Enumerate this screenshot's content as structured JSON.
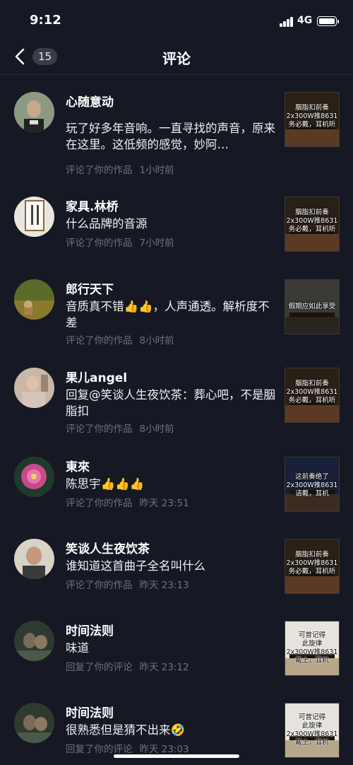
{
  "status_bar": {
    "time": "9:12",
    "network": "4G"
  },
  "nav": {
    "back_icon": "chevron-left-icon",
    "badge_count": "15",
    "title": "评论"
  },
  "items": [
    {
      "user": "心随意动",
      "comment": "玩了好多年音响。一直寻找的声音，原来在这里。这低频的感觉，妙阿…",
      "action": "评论了你的作品",
      "time": "1小时前",
      "thumb_caption": "胭脂扣前奏\n2x300W推8631\n务必戴，耳机听"
    },
    {
      "user": "家具.林桥",
      "comment": "什么品牌的音源",
      "action": "评论了你的作品",
      "time": "7小时前",
      "thumb_caption": "胭脂扣前奏\n2x300W推8631\n务必戴，耳机听"
    },
    {
      "user": "郎行天下",
      "comment": "音质真不错👍👍，人声通透。解析度不差",
      "action": "评论了你的作品",
      "time": "8小时前",
      "thumb_caption": "假期应如此享受"
    },
    {
      "user": "果儿angel",
      "comment": "回复@笑谈人生夜饮茶：葬心吧，不是胭脂扣",
      "action": "评论了你的作品",
      "time": "8小时前",
      "thumb_caption": "胭脂扣前奏\n2x300W推8631\n务必戴，耳机听"
    },
    {
      "user": "東來",
      "comment": "陈思宇👍👍👍",
      "action": "评论了你的作品",
      "time": "昨天 23:51",
      "thumb_caption": "这前奏绝了\n2x300W推8631\n请戴，耳机"
    },
    {
      "user": "笑谈人生夜饮茶",
      "comment": "谁知道这首曲子全名叫什么",
      "action": "评论了你的作品",
      "time": "昨天 23:13",
      "thumb_caption": "胭脂扣前奏\n2x300W推8631\n务必戴，耳机听"
    },
    {
      "user": "时间法则",
      "comment": "味道",
      "action": "回复了你的评论",
      "time": "昨天 23:12",
      "thumb_caption": "可曾记得\n此旋律\n2x300W推8631\n戴上，耳机"
    },
    {
      "user": "时间法则",
      "comment": "很熟悉但是猜不出来🤣",
      "action": "回复了你的评论",
      "time": "昨天 23:03",
      "thumb_caption": "可曾记得\n此旋律\n2x300W推8631\n戴上，耳机"
    }
  ]
}
